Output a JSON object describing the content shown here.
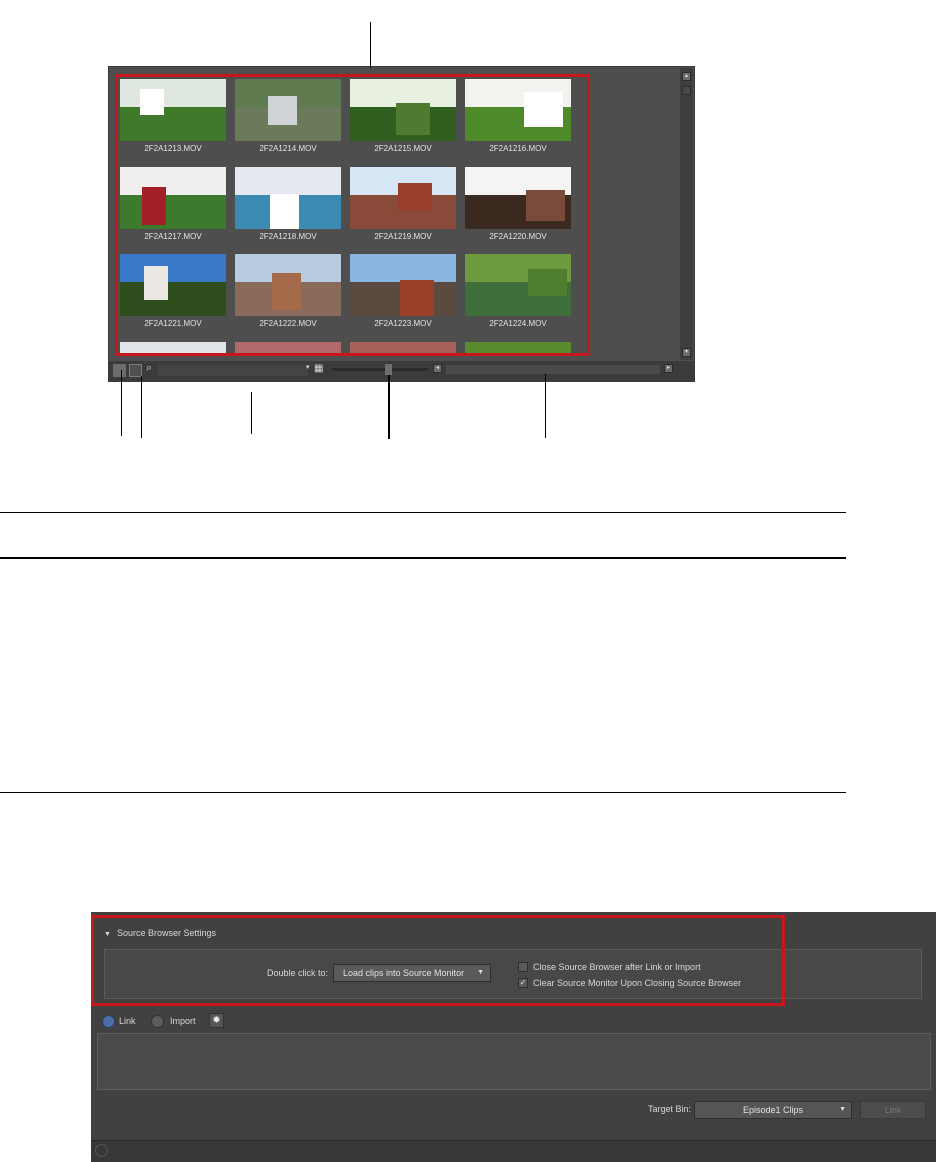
{
  "thumbnails": [
    {
      "filename": "2F2A1213.MOV",
      "sky": "#dfe8e0",
      "ground": "#3e7a2a",
      "obj": "#ffffff"
    },
    {
      "filename": "2F2A1214.MOV",
      "sky": "#5f7a4f",
      "ground": "#6a7a5a",
      "obj": "#cfd3d6"
    },
    {
      "filename": "2F2A1215.MOV",
      "sky": "#e8f0e0",
      "ground": "#2f5e1f",
      "obj": "#4f7a2f"
    },
    {
      "filename": "2F2A1216.MOV",
      "sky": "#f2f2ee",
      "ground": "#4e8a2a",
      "obj": "#ffffff"
    },
    {
      "filename": "2F2A1217.MOV",
      "sky": "#f0eeee",
      "ground": "#3e7a2e",
      "obj": "#a41e2a"
    },
    {
      "filename": "2F2A1218.MOV",
      "sky": "#e5e8f0",
      "ground": "#3a8ab2",
      "obj": "#ffffff"
    },
    {
      "filename": "2F2A1219.MOV",
      "sky": "#d6e6f4",
      "ground": "#8a4a3a",
      "obj": "#9a3e2c"
    },
    {
      "filename": "2F2A1220.MOV",
      "sky": "#f4f4f4",
      "ground": "#3a2a20",
      "obj": "#7a4a3a"
    },
    {
      "filename": "2F2A1221.MOV",
      "sky": "#3a78c8",
      "ground": "#2e4e1e",
      "obj": "#ece8e4"
    },
    {
      "filename": "2F2A1222.MOV",
      "sky": "#b8cce0",
      "ground": "#8a6a5a",
      "obj": "#a46a4a"
    },
    {
      "filename": "2F2A1223.MOV",
      "sky": "#8ab4e0",
      "ground": "#5a4a40",
      "obj": "#9a3e2a"
    },
    {
      "filename": "2F2A1224.MOV",
      "sky": "#6e9a3e",
      "ground": "#3e6e3a",
      "obj": "#4e7e2e"
    },
    {
      "filename": "",
      "sky": "#dfe4e8",
      "ground": "#3a5a2a",
      "obj": "#ffffff"
    },
    {
      "filename": "",
      "sky": "#b06a6a",
      "ground": "#9a5a5a",
      "obj": "#b86e6e"
    },
    {
      "filename": "",
      "sky": "#a8605a",
      "ground": "#945a58",
      "obj": "#b4706a"
    },
    {
      "filename": "",
      "sky": "#5a8a2e",
      "ground": "#3e6a26",
      "obj": "#6e9a3a"
    }
  ],
  "source_settings": {
    "header": "Source Browser Settings",
    "double_click_label": "Double click to:",
    "double_click_value": "Load clips into Source Monitor",
    "options": [
      {
        "label": "Close Source Browser after Link or Import",
        "checked": false
      },
      {
        "label": "Clear Source Monitor Upon Closing Source Browser",
        "checked": true
      }
    ]
  },
  "mode": {
    "link_label": "Link",
    "import_label": "Import",
    "selected": "Link"
  },
  "target": {
    "label": "Target Bin:",
    "value": "Episode1 Clips"
  },
  "action_button": "Link"
}
